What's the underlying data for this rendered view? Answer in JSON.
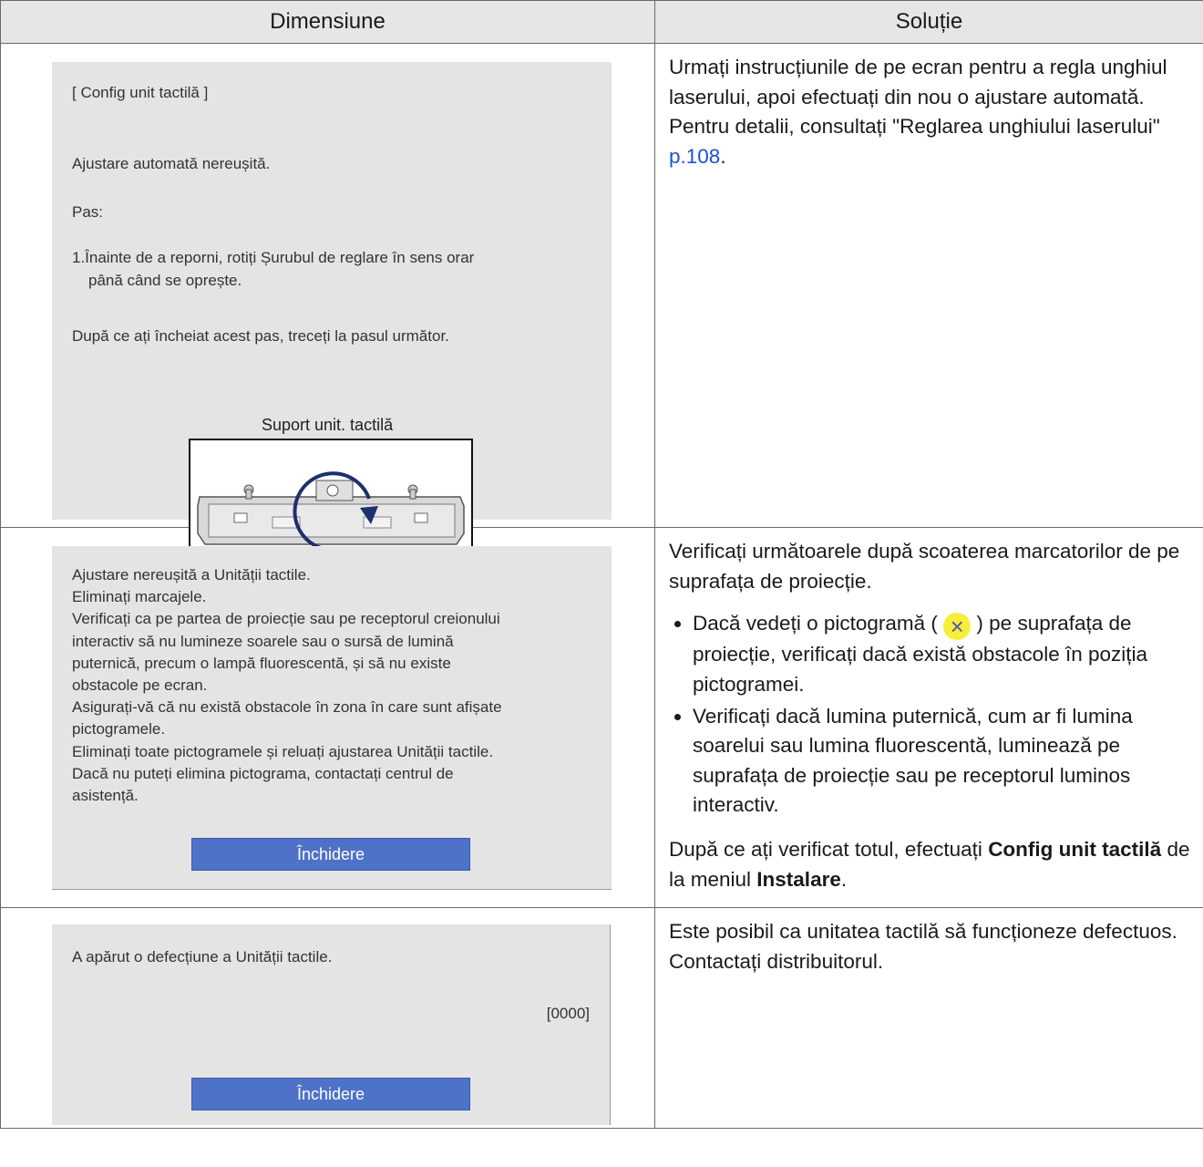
{
  "header": {
    "col1": "Dimensiune",
    "col2": "Soluție"
  },
  "row1": {
    "screen": {
      "title": "[ Config unit tactilă ]",
      "line1": "Ajustare automată nereușită.",
      "step_label": "Pas:",
      "step1_a": "1.Înainte de a reporni, rotiți Șurubul de reglare în sens orar",
      "step1_b": "până când se oprește.",
      "after": "După ce ați încheiat acest pas, treceți la pasul următor.",
      "diagram_label": "Suport unit. tactilă"
    },
    "solution": {
      "text": "Urmați instrucțiunile de pe ecran pentru a regla unghiul laserului, apoi efectuați din nou o ajustare automată. Pentru detalii, consultați \"Reglarea unghiului laserului\" ",
      "link": "p.108",
      "end": "."
    }
  },
  "row2": {
    "screen": {
      "lines": [
        "Ajustare nereușită a Unității tactile.",
        "Eliminați marcajele.",
        "Verificați ca pe partea de proiecție sau pe receptorul creionului",
        "interactiv să nu lumineze soarele sau o sursă de lumină",
        "puternică, precum o lampă fluorescentă, și să nu existe",
        "obstacole pe ecran.",
        "Asigurați-vă că nu există obstacole în zona în care sunt afișate",
        "pictogramele.",
        "Eliminați toate pictogramele și reluați ajustarea Unității tactile.",
        "Dacă nu puteți elimina pictograma, contactați centrul de",
        "asistență."
      ],
      "button": "Închidere"
    },
    "solution": {
      "intro": "Verificați următoarele după scoaterea marcatorilor de pe suprafața de proiecție.",
      "bullet1_a": "Dacă vedeți o pictogramă (",
      "bullet1_b": ") pe suprafața de proiecție, verificați dacă există obstacole în poziția pictogramei.",
      "bullet2": "Verificați dacă lumina puternică, cum ar fi lumina soarelui sau lumina fluorescentă, luminează pe suprafața de proiecție sau pe receptorul luminos interactiv.",
      "outro_a": "După ce ați verificat totul, efectuați ",
      "outro_bold1": "Config unit tactilă",
      "outro_b": " de la meniul ",
      "outro_bold2": "Instalare",
      "outro_c": "."
    }
  },
  "row3": {
    "screen": {
      "line1": "A apărut o defecțiune a Unității tactile.",
      "code": "[0000]",
      "button": "Închidere"
    },
    "solution": {
      "text": "Este posibil ca unitatea tactilă să funcționeze defectuos. Contactați distribuitorul."
    }
  },
  "icons": {
    "close_marker": "close-x-icon",
    "rotate_arrow": "rotate-arrow-icon"
  },
  "colors": {
    "button": "#4e72c7",
    "link": "#1f4fd6",
    "marker": "#f7ee3a"
  }
}
